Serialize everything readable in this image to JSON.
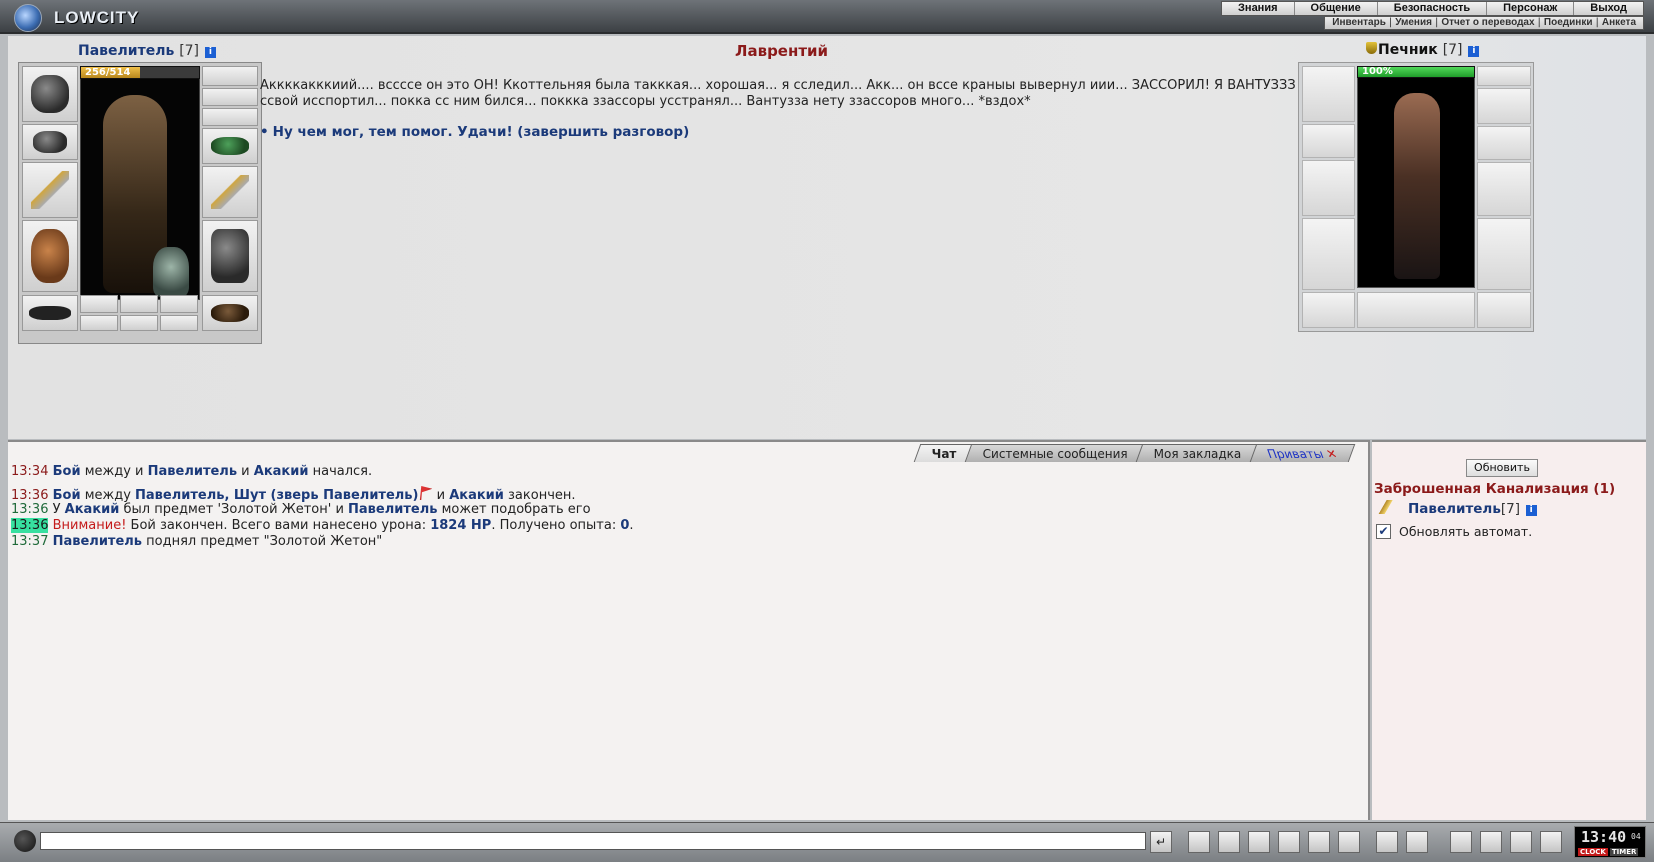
{
  "app": {
    "logo_text": "LOWCITY"
  },
  "menu": {
    "row1": [
      "Знания",
      "Общение",
      "Безопасность",
      "Персонаж",
      "Выход"
    ],
    "row2": [
      "Инвентарь",
      "Умения",
      "Отчет о переводах",
      "Поединки",
      "Анкета"
    ]
  },
  "player": {
    "name": "Павелитель",
    "level": "[7]",
    "hp_text": "256/514",
    "hp_fraction": 0.498
  },
  "npc": {
    "name": "Печник",
    "level": "[7]",
    "hp_text": "100%",
    "hp_fraction": 1.0
  },
  "dialog": {
    "speaker": "Лаврентий",
    "text": "Аккккакккиий.... вссссе он это ОН! Ккоттельняя была такккая... хорошая... я сследил... Акк... он вссе краныы вывернул иии... ЗАССОРИЛ! Я ВАНТУЗЗЗ ссвой исспортил... покка сс ним бился... поккка ззассоры усстранял... Вантузза нету ззассоров много... *вздох*",
    "reply": "Ну чем мог, тем помог. Удачи! (завершить разговор)"
  },
  "tabs": [
    {
      "label": "Чат"
    },
    {
      "label": "Системные сообщения"
    },
    {
      "label": "Моя закладка"
    },
    {
      "label": "Приваты"
    }
  ],
  "chat": [
    {
      "time": "13:34",
      "parts": [
        "Бой",
        " между ",
        "и",
        " ",
        "Павелитель",
        " и ",
        "Акакий",
        " начался."
      ]
    },
    {
      "time": "13:36",
      "parts": [
        "Бой",
        " между ",
        "Павелитель, Шут (зверь Павелитель)",
        " и ",
        "Акакий",
        " закончен."
      ]
    },
    {
      "time": "13:36",
      "parts": [
        "У ",
        "Акакий",
        " был предмет 'Золотой Жетон' и ",
        "Павелитель",
        " может подобрать его"
      ]
    },
    {
      "time": "13:36",
      "parts": [
        "Внимание!",
        " Бой закончен. Всего вами нанесено урона: ",
        "1824 HP",
        ". Получено опыта: ",
        "0",
        "."
      ]
    },
    {
      "time": "13:37",
      "parts": [
        "Павелитель",
        " поднял предмет \"Золотой Жетон\""
      ]
    }
  ],
  "online": {
    "refresh_label": "Обновить",
    "location": "Заброшенная Канализация (1)",
    "user_name": "Павелитель",
    "user_level": "[7]",
    "auto_label": "Обновлять автомат.",
    "auto_checked": "✔"
  },
  "clock": {
    "time": "13:40",
    "seconds": "04",
    "label_clock": "CLOCK",
    "label_timer": "TIMER"
  },
  "info_icon_text": "i",
  "tab_close": "✕",
  "send_arrow": "↵"
}
